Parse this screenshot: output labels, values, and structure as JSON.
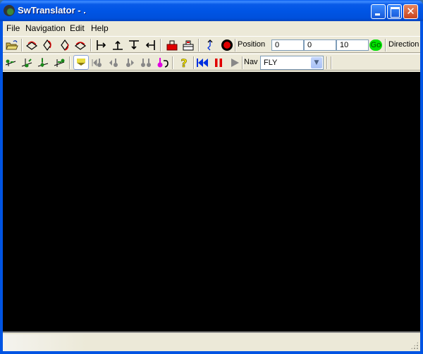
{
  "window": {
    "title": "SwTranslator - .",
    "controls": {
      "minimize": "minimize",
      "maximize": "maximize",
      "close": "close"
    }
  },
  "menubar": {
    "items": [
      {
        "label": "File"
      },
      {
        "label": "Navigation"
      },
      {
        "label": "Edit"
      },
      {
        "label": "Help"
      }
    ]
  },
  "toolbar1": {
    "buttons": [
      {
        "icon": "open-folder-icon"
      },
      {
        "icon": "rotate-left-icon"
      },
      {
        "icon": "rotate-up-icon"
      },
      {
        "icon": "rotate-down-icon"
      },
      {
        "icon": "rotate-right-icon"
      },
      {
        "icon": "align-left-icon"
      },
      {
        "icon": "align-bottom-icon"
      },
      {
        "icon": "align-top-icon"
      },
      {
        "icon": "align-right-icon"
      },
      {
        "icon": "red-stamp-icon"
      },
      {
        "icon": "outline-stamp-icon"
      },
      {
        "icon": "blue-path-icon"
      },
      {
        "icon": "record-icon"
      }
    ],
    "position_label": "Position",
    "position": {
      "x": "0",
      "y": "0",
      "z": "10"
    },
    "go_label": "Go",
    "direction_label": "Direction"
  },
  "toolbar2": {
    "buttons": [
      {
        "icon": "axis-move-1-icon"
      },
      {
        "icon": "axis-move-2-icon"
      },
      {
        "icon": "axis-move-3-icon"
      },
      {
        "icon": "axis-move-4-icon"
      },
      {
        "icon": "light-fan-icon",
        "active": true
      },
      {
        "icon": "skip-start-node-icon"
      },
      {
        "icon": "prev-node-icon"
      },
      {
        "icon": "next-node-icon"
      },
      {
        "icon": "pair-nodes-icon"
      },
      {
        "icon": "undo-node-icon"
      },
      {
        "icon": "help-icon"
      },
      {
        "icon": "rewind-icon"
      },
      {
        "icon": "pause-icon"
      },
      {
        "icon": "play-icon"
      }
    ],
    "nav_label": "Nav",
    "nav_value": "FLY"
  },
  "colors": {
    "title_bar": "#0055e5",
    "chrome": "#ece9d8",
    "viewport": "#000000",
    "go": "#00e000",
    "accent_red": "#e00000",
    "accent_blue": "#0030e0"
  }
}
